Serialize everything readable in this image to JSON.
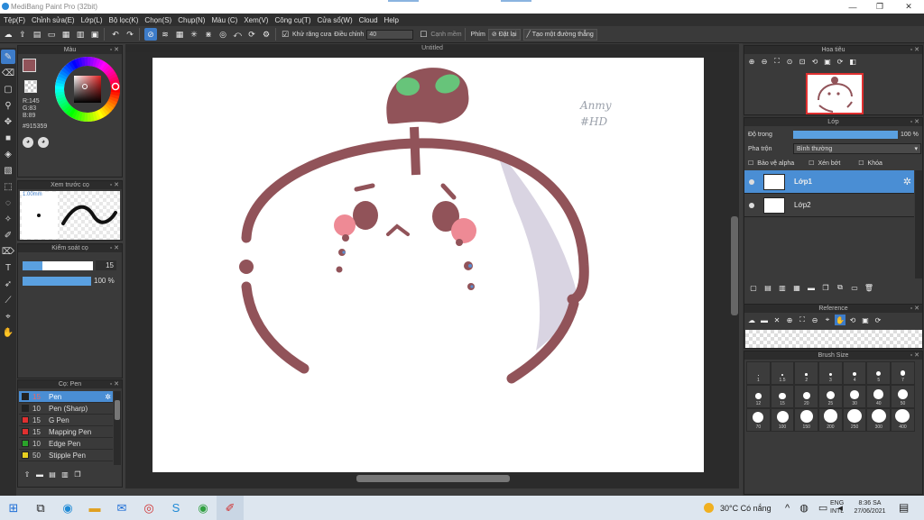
{
  "title": {
    "app": "MediBang Paint Pro (32bit)"
  },
  "menu": [
    "Tệp(F)",
    "Chỉnh sửa(E)",
    "Lớp(L)",
    "Bộ lọc(K)",
    "Chọn(S)",
    "Chụp(N)",
    "Màu (C)",
    "Xem(V)",
    "Công cụ(T)",
    "Cửa sổ(W)",
    "Cloud",
    "Help"
  ],
  "toolbar": {
    "antialias_label": "Khử răng cưa",
    "adjust_label": "Điều chỉnh",
    "adjust_value": "40",
    "correct_label": "Cạnh mềm",
    "key_label": "Phím",
    "reset_label": "Đặt lại",
    "straight_label": "Tạo một đường thẳng"
  },
  "color_panel": {
    "title": "Màu",
    "r": "R:145",
    "g": "G:83",
    "b": "B:89",
    "hex": "#915359",
    "primary": "#915359"
  },
  "brush_preview": {
    "title": "Xem trước cọ",
    "size_label": "1.00mm"
  },
  "brush_control": {
    "title": "Kiểm soát cọ",
    "size": "15",
    "opacity": "100 %",
    "size_frac": 0.28,
    "opacity_frac": 1.0
  },
  "brush_list": {
    "title": "Cọ: Pen",
    "items": [
      {
        "size": "15",
        "name": "Pen",
        "color": "#222222"
      },
      {
        "size": "10",
        "name": "Pen (Sharp)",
        "color": "#222222"
      },
      {
        "size": "15",
        "name": "G Pen",
        "color": "#e03030"
      },
      {
        "size": "15",
        "name": "Mapping Pen",
        "color": "#e03030"
      },
      {
        "size": "10",
        "name": "Edge Pen",
        "color": "#2aa32a"
      },
      {
        "size": "50",
        "name": "Stipple Pen",
        "color": "#e8d020"
      }
    ]
  },
  "canvas": {
    "tab": "Untitled",
    "signature_text": "Anmy #HD"
  },
  "navigator": {
    "title": "Hoa tiêu"
  },
  "layer_panel": {
    "title": "Lớp",
    "opacity_label": "Độ trong",
    "opacity_value": "100 %",
    "blend_label": "Pha trộn",
    "blend_value": "Bình thường",
    "protect_alpha": "Bảo vệ alpha",
    "clipping": "Xén bớt",
    "lock": "Khóa",
    "layers": [
      {
        "name": "Lớp1"
      },
      {
        "name": "Lớp2"
      }
    ]
  },
  "reference_panel": {
    "title": "Reference"
  },
  "brush_size_panel": {
    "title": "Brush Size",
    "sizes": [
      "1",
      "1.5",
      "2",
      "3",
      "4",
      "5",
      "7",
      "12",
      "15",
      "20",
      "25",
      "30",
      "40",
      "50",
      "70",
      "100",
      "150",
      "200",
      "250",
      "300",
      "400"
    ]
  },
  "taskbar": {
    "weather": "30°C Có nắng",
    "lang1": "ENG",
    "lang2": "INTL",
    "time": "8:36 SA",
    "date": "27/06/2021"
  }
}
